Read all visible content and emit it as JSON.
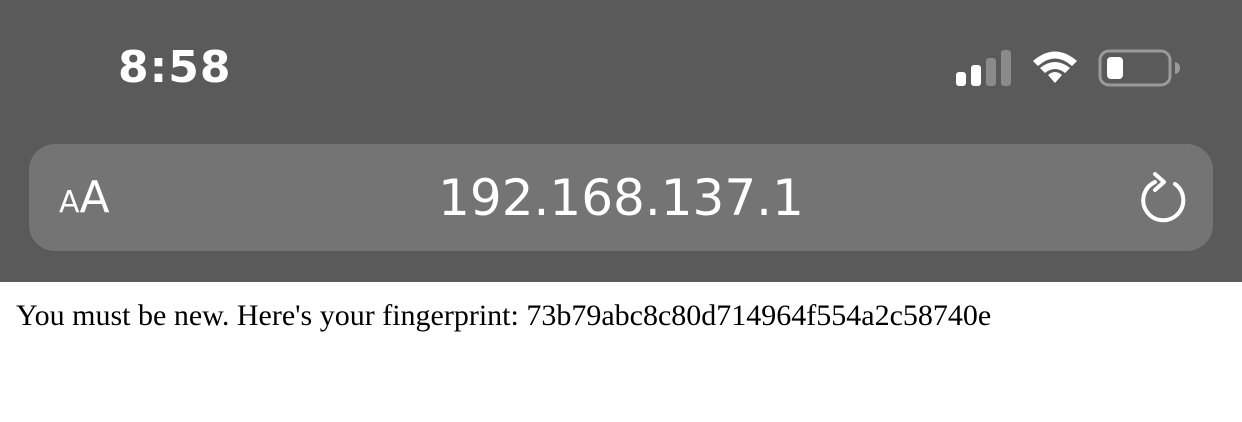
{
  "status_bar": {
    "time": "8:58",
    "signal_icon": "cellular-signal-icon",
    "signal_bars_active": 2,
    "signal_bars_total": 4,
    "wifi_icon": "wifi-icon",
    "battery_icon": "battery-icon",
    "battery_level": 0.2
  },
  "address_bar": {
    "text_size_small": "A",
    "text_size_large": "A",
    "url": "192.168.137.1",
    "reload_icon": "reload-icon"
  },
  "page": {
    "text": "You must be new. Here's your fingerprint: 73b79abc8c80d714964f554a2c58740e"
  },
  "colors": {
    "chrome_background": "#5a5a5a",
    "url_bar_background": "#747474",
    "page_background": "#ffffff"
  }
}
